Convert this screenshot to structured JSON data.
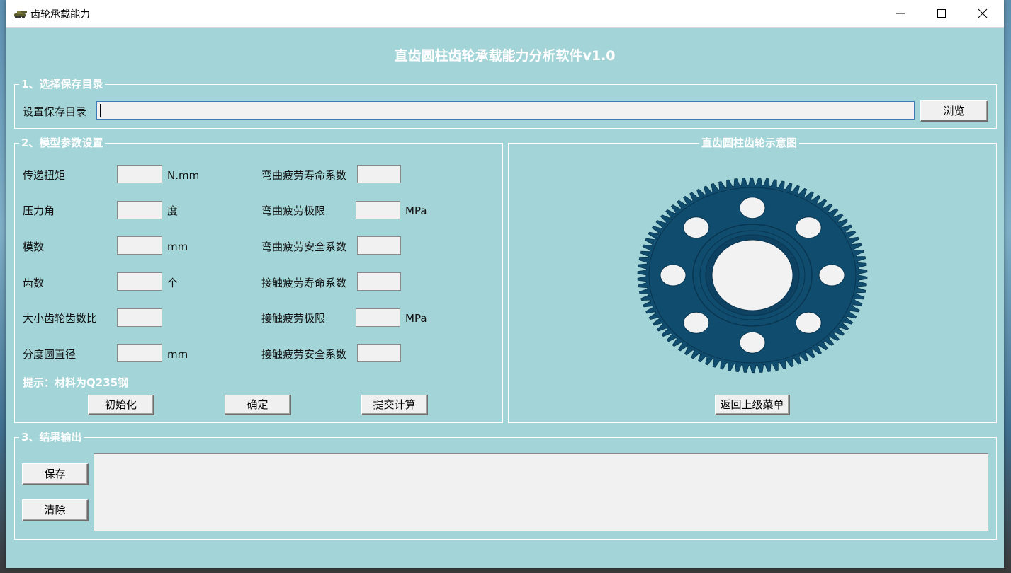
{
  "window": {
    "title": "齿轮承载能力",
    "app_icon": "tank-icon"
  },
  "controls": {
    "minimize": "minimize-icon",
    "maximize": "maximize-icon",
    "close": "close-icon"
  },
  "main_title": "直齿圆柱齿轮承载能力分析软件v1.0",
  "section1": {
    "title": "1、选择保存目录",
    "label": "设置保存目录",
    "path_value": "",
    "browse_label": "浏览"
  },
  "section2": {
    "title": "2、模型参数设置",
    "left_params": [
      {
        "label": "传递扭矩",
        "unit": "N.mm",
        "value": ""
      },
      {
        "label": "压力角",
        "unit": "度",
        "value": ""
      },
      {
        "label": "模数",
        "unit": "mm",
        "value": ""
      },
      {
        "label": "齿数",
        "unit": "个",
        "value": ""
      },
      {
        "label": "大小齿轮齿数比",
        "unit": "",
        "value": ""
      },
      {
        "label": "分度圆直径",
        "unit": "mm",
        "value": ""
      }
    ],
    "right_params": [
      {
        "label": "弯曲疲劳寿命系数",
        "unit": "",
        "value": ""
      },
      {
        "label": "弯曲疲劳极限",
        "unit": "MPa",
        "value": ""
      },
      {
        "label": "弯曲疲劳安全系数",
        "unit": "",
        "value": ""
      },
      {
        "label": "接触疲劳寿命系数",
        "unit": "",
        "value": ""
      },
      {
        "label": "接触疲劳极限",
        "unit": "MPa",
        "value": ""
      },
      {
        "label": "接触疲劳安全系数",
        "unit": "",
        "value": ""
      }
    ],
    "hint": "提示：材料为Q235钢",
    "buttons": {
      "init": "初始化",
      "confirm": "确定",
      "submit": "提交计算"
    }
  },
  "diagram": {
    "title": "直齿圆柱齿轮示意图",
    "back_label": "返回上级菜单",
    "gear_color": "#0f4c6e"
  },
  "section3": {
    "title": "3、结果输出",
    "save_label": "保存",
    "clear_label": "清除",
    "output": ""
  }
}
